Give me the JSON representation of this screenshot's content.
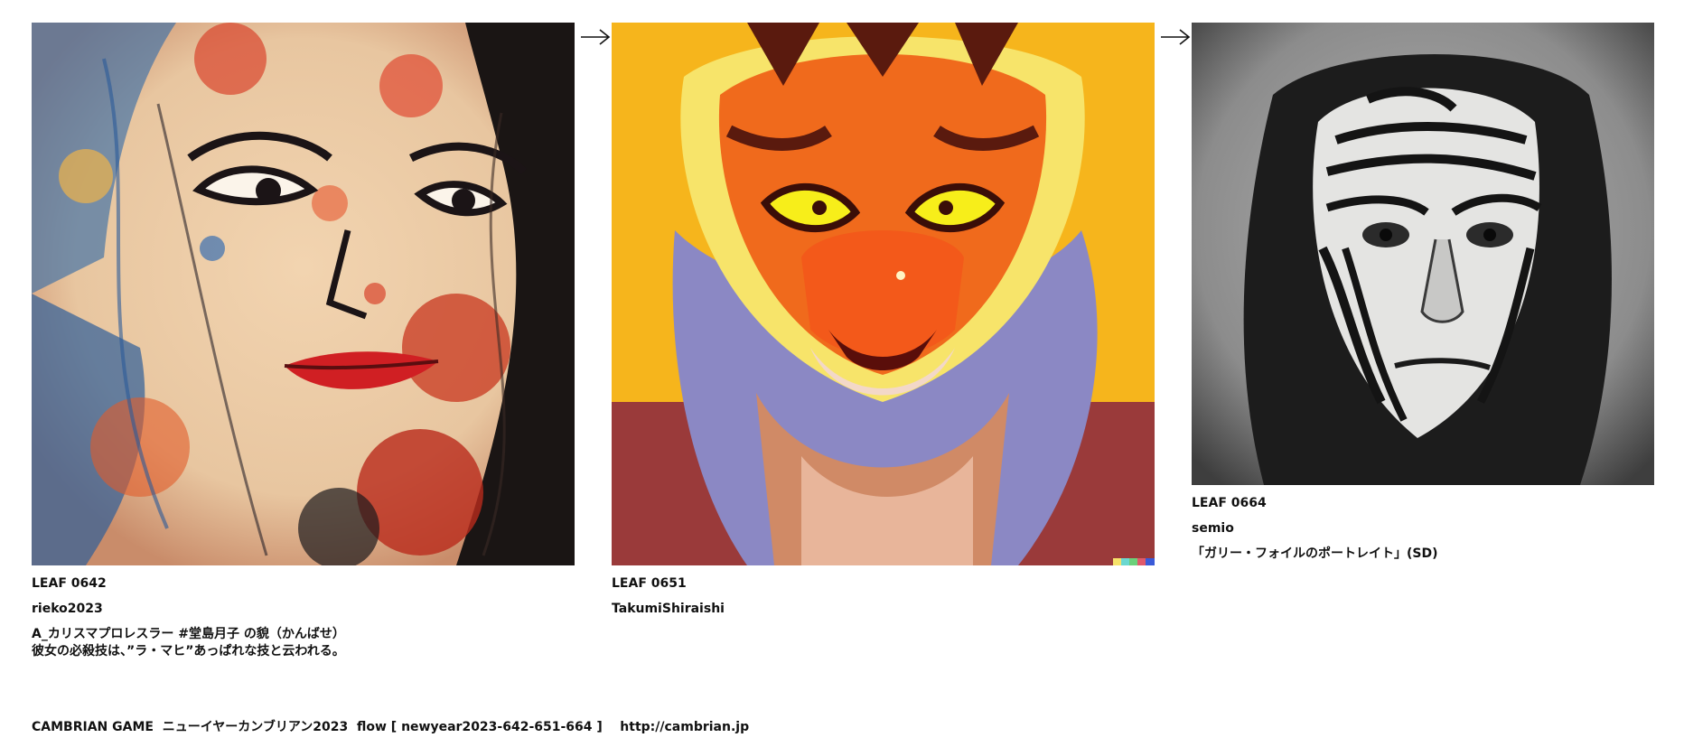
{
  "leaves": [
    {
      "leaf": "LEAF 0642",
      "author": "rieko2023",
      "description": "A_カリスマプロレスラー #堂島月子 の貌（かんばせ）\n彼女の必殺技は、”ラ・マヒ”あっぱれな技と云われる。",
      "image": "abstract-paint-splatter-woman-portrait"
    },
    {
      "leaf": "LEAF 0651",
      "author": "TakumiShiraishi",
      "description": "",
      "image": "painted-tiger-character-in-hoodie"
    },
    {
      "leaf": "LEAF 0664",
      "author": "semio",
      "description": "「ガリー・フォイルのポートレイト」(SD)",
      "image": "black-and-white-tiger-striped-face-man-photo"
    }
  ],
  "arrow_icon": "right-arrow-icon",
  "footer": {
    "text": "CAMBRIAN GAME  ニューイヤーカンブリアン2023  flow [ newyear2023-642-651-664 ]    http://cambrian.jp"
  }
}
